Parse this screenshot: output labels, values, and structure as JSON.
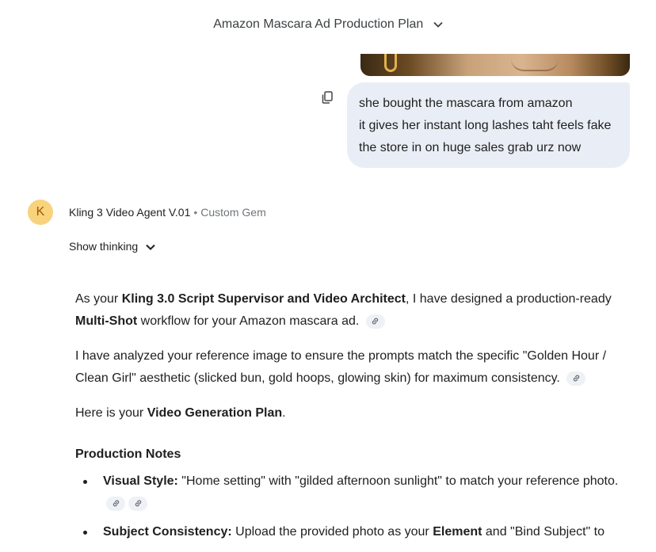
{
  "header": {
    "title": "Amazon Mascara Ad Production Plan"
  },
  "user_message": {
    "lines": [
      "she bought the mascara from amazon",
      "it gives her instant long lashes taht feels fake",
      "the store in on huge sales grab urz now"
    ]
  },
  "agent": {
    "avatar_letter": "K",
    "name": "Kling 3 Video Agent V.01",
    "separator": "•",
    "tag": "Custom Gem",
    "show_thinking": "Show thinking"
  },
  "response": {
    "p1": {
      "a": "As your ",
      "b1": "Kling 3.0 Script Supervisor and Video Architect",
      "c": ", I have designed a production-ready ",
      "b2": "Multi-Shot",
      "d": " workflow for your Amazon mascara ad."
    },
    "p2": "I have analyzed your reference image to ensure the prompts match the specific \"Golden Hour / Clean Girl\" aesthetic (slicked bun, gold hoops, glowing skin) for maximum consistency.",
    "p3": {
      "a": "Here is your ",
      "b": "Video Generation Plan",
      "c": "."
    },
    "section_title": "Production Notes",
    "notes": [
      {
        "label": "Visual Style:",
        "text": " \"Home setting\" with \"gilded afternoon sunlight\" to match your reference photo."
      },
      {
        "label": "Subject Consistency:",
        "text_a": " Upload the provided photo as your ",
        "bold": "Element",
        "text_b": " and \"Bind Subject\" to"
      }
    ]
  },
  "colors": {
    "bubble": "#e9eef6",
    "avatar_bg": "#f9d27c",
    "avatar_fg": "#9a5b00",
    "cite_bg": "#eef1f5"
  },
  "icons": [
    "chevron-down-icon",
    "copy-icon",
    "link-icon"
  ]
}
